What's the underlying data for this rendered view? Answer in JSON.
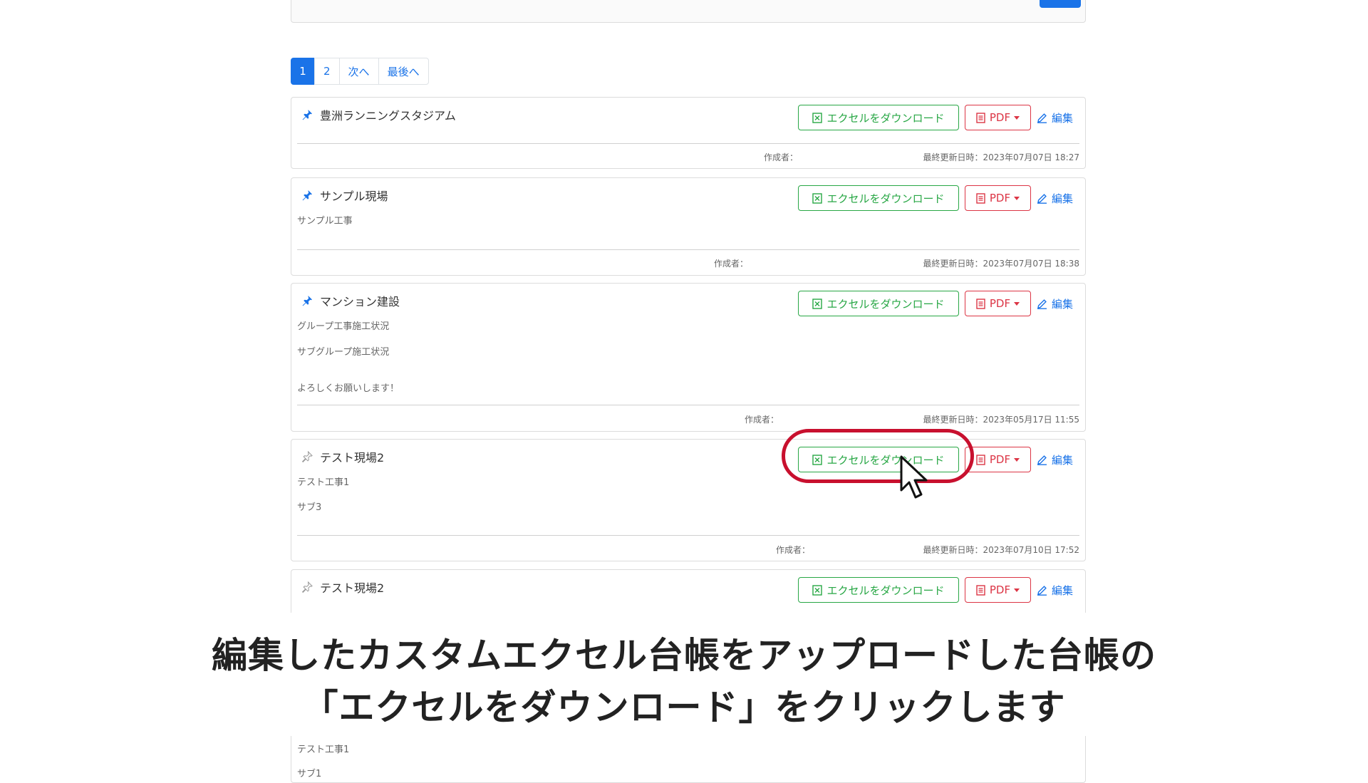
{
  "pagination": {
    "items": [
      "1",
      "2",
      "次へ",
      "最後へ"
    ]
  },
  "buttons": {
    "excel": "エクセルをダウンロード",
    "pdf": "PDF",
    "edit": "編集"
  },
  "cards": [
    {
      "title": "豊洲ランニングスタジアム",
      "pinned": true,
      "lines": [],
      "author_label": "作成者：",
      "updated": "最終更新日時：2023年07月07日 18:27"
    },
    {
      "title": "サンプル現場",
      "pinned": true,
      "lines": [
        "サンプル工事"
      ],
      "author_label": "作成者：",
      "updated": "最終更新日時：2023年07月07日 18:38"
    },
    {
      "title": "マンション建設",
      "pinned": true,
      "lines": [
        "グループ工事施工状況",
        "サブグループ施工状況",
        "よろしくお願いします！"
      ],
      "author_label": "作成者：",
      "updated": "最終更新日時：2023年05月17日 11:55"
    },
    {
      "title": "テスト現場2",
      "pinned": false,
      "lines": [
        "テスト工事1",
        "サブ3"
      ],
      "author_label": "作成者：",
      "updated": "最終更新日時：2023年07月10日 17:52"
    },
    {
      "title": "テスト現場2",
      "pinned": false,
      "lines": [
        "テスト工事1",
        "サブ1"
      ],
      "author_label": "",
      "updated": ""
    }
  ],
  "caption": {
    "line1": "編集したカスタムエクセル台帳をアップロードした台帳の",
    "line2": "「エクセルをダウンロード」をクリックします"
  },
  "colors": {
    "primary": "#1a73e8",
    "excel": "#28a745",
    "pdf": "#dc3545",
    "highlight": "#c8102e"
  }
}
